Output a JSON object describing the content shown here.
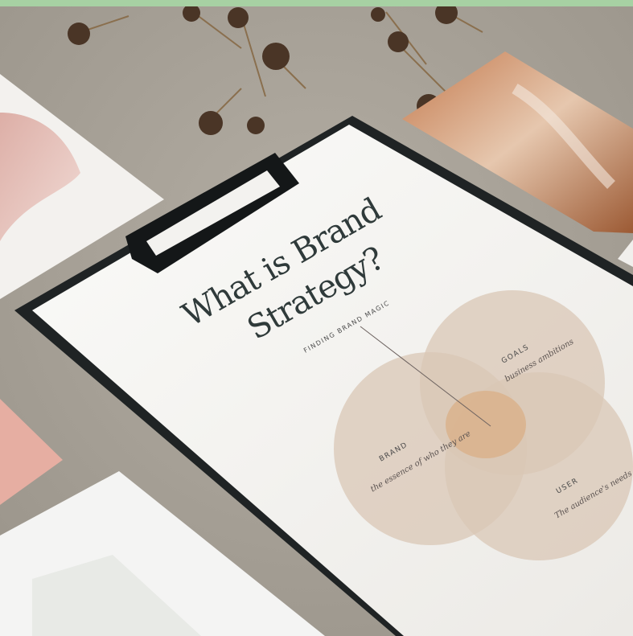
{
  "board": {
    "title_line1": "What is Brand",
    "title_line2": "Strategy?",
    "subtitle": "FINDING BRAND MAGIC"
  },
  "venn": {
    "goals": {
      "label": "GOALS",
      "description": "business ambitions"
    },
    "brand": {
      "label": "BRAND",
      "description": "the essence of who they are"
    },
    "user": {
      "label": "USER",
      "description": "The audience's needs"
    }
  },
  "colors": {
    "top_bar": "#a7d1a3",
    "table": "#a9a298",
    "clipboard": "#1f2324",
    "paper": "#f3f2ef",
    "circle": "#d9c7b5",
    "overlap": "#d9b08a"
  }
}
